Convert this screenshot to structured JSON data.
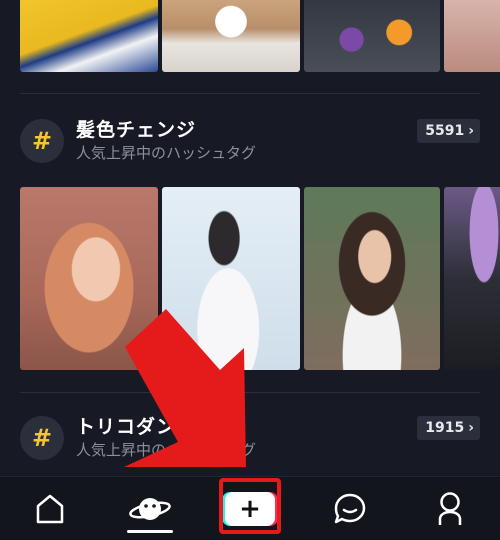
{
  "tags": [
    {
      "title": "髪色チェンジ",
      "subtitle": "人気上昇中のハッシュタグ",
      "count": "5591",
      "hash_symbol": "#"
    },
    {
      "title": "トリコダンス",
      "subtitle": "人気上昇中のハッシュタグ",
      "count": "1915",
      "hash_symbol": "#"
    }
  ],
  "tabbar": {
    "items": [
      {
        "icon": "home-icon"
      },
      {
        "icon": "discover-planet-icon",
        "active": true
      },
      {
        "icon": "create-plus-icon"
      },
      {
        "icon": "inbox-chat-icon"
      },
      {
        "icon": "profile-icon"
      }
    ],
    "create_symbol": "+"
  },
  "colors": {
    "background": "#171a24",
    "hash_accent": "#f7c531",
    "annotation_red": "#e51b1b",
    "create_cyan": "#25f4ee",
    "create_pink": "#fe2c55"
  }
}
